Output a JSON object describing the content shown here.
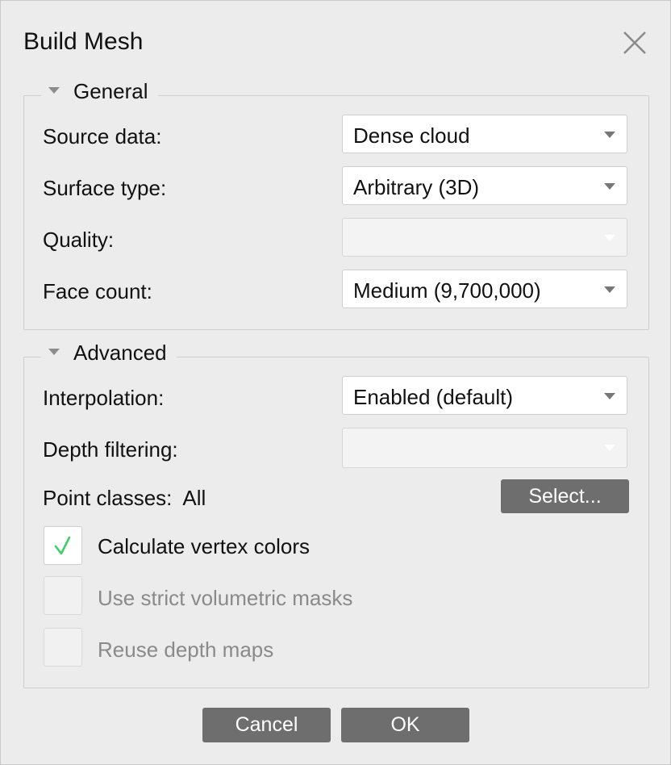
{
  "dialog": {
    "title": "Build Mesh"
  },
  "general": {
    "label": "General",
    "fields": {
      "source_data": {
        "label": "Source data:",
        "value": "Dense cloud"
      },
      "surface_type": {
        "label": "Surface type:",
        "value": "Arbitrary (3D)"
      },
      "quality": {
        "label": "Quality:",
        "value": ""
      },
      "face_count": {
        "label": "Face count:",
        "value": "Medium (9,700,000)"
      }
    }
  },
  "advanced": {
    "label": "Advanced",
    "fields": {
      "interpolation": {
        "label": "Interpolation:",
        "value": "Enabled (default)"
      },
      "depth_filtering": {
        "label": "Depth filtering:",
        "value": ""
      },
      "point_classes": {
        "label": "Point classes:",
        "value": "All",
        "button": "Select..."
      }
    },
    "checkboxes": {
      "calculate_vertex_colors": {
        "label": "Calculate vertex colors",
        "checked": true,
        "enabled": true
      },
      "strict_volumetric_masks": {
        "label": "Use strict volumetric masks",
        "checked": false,
        "enabled": false
      },
      "reuse_depth_maps": {
        "label": "Reuse depth maps",
        "checked": false,
        "enabled": false
      }
    }
  },
  "buttons": {
    "cancel": "Cancel",
    "ok": "OK"
  },
  "icons": {
    "close": "close-icon",
    "collapse": "triangle-down-icon",
    "dropdown": "chevron-down-icon",
    "check": "checkmark-icon"
  },
  "colors": {
    "checkmark": "#3fcf6a",
    "button_bg": "#6e6e6e"
  }
}
